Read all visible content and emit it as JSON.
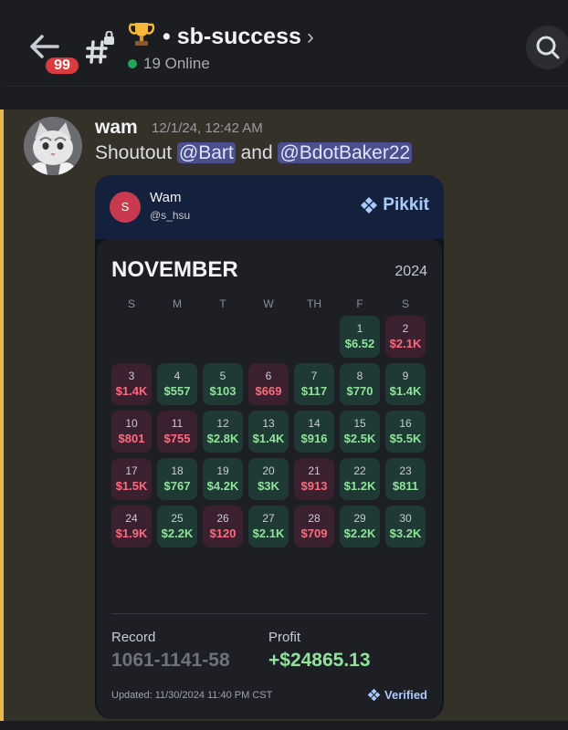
{
  "header": {
    "unread_count": "99",
    "channel_emoji": "trophy-icon",
    "channel_name": "• sb-success",
    "chevron": "›",
    "online_text": "19 Online"
  },
  "message": {
    "author": "wam",
    "timestamp": "12/1/24, 12:42 AM",
    "text_prefix": "Shoutout ",
    "mention_1": "@Bart",
    "text_middle": " and ",
    "mention_2": "@BdotBaker22"
  },
  "card": {
    "avatar_initial": "S",
    "user_name": "Wam",
    "user_handle": "@s_hsu",
    "brand": "Pikkit",
    "month": "NOVEMBER",
    "year": "2024",
    "weekdays": [
      "S",
      "M",
      "T",
      "W",
      "TH",
      "F",
      "S"
    ],
    "days": [
      {
        "day": "1",
        "amount": "$6.52",
        "result": "win"
      },
      {
        "day": "2",
        "amount": "$2.1K",
        "result": "loss"
      },
      {
        "day": "3",
        "amount": "$1.4K",
        "result": "loss"
      },
      {
        "day": "4",
        "amount": "$557",
        "result": "win"
      },
      {
        "day": "5",
        "amount": "$103",
        "result": "win"
      },
      {
        "day": "6",
        "amount": "$669",
        "result": "loss"
      },
      {
        "day": "7",
        "amount": "$117",
        "result": "win"
      },
      {
        "day": "8",
        "amount": "$770",
        "result": "win"
      },
      {
        "day": "9",
        "amount": "$1.4K",
        "result": "win"
      },
      {
        "day": "10",
        "amount": "$801",
        "result": "loss"
      },
      {
        "day": "11",
        "amount": "$755",
        "result": "loss"
      },
      {
        "day": "12",
        "amount": "$2.8K",
        "result": "win"
      },
      {
        "day": "13",
        "amount": "$1.4K",
        "result": "win"
      },
      {
        "day": "14",
        "amount": "$916",
        "result": "win"
      },
      {
        "day": "15",
        "amount": "$2.5K",
        "result": "win"
      },
      {
        "day": "16",
        "amount": "$5.5K",
        "result": "win"
      },
      {
        "day": "17",
        "amount": "$1.5K",
        "result": "loss"
      },
      {
        "day": "18",
        "amount": "$767",
        "result": "win"
      },
      {
        "day": "19",
        "amount": "$4.2K",
        "result": "win"
      },
      {
        "day": "20",
        "amount": "$3K",
        "result": "win"
      },
      {
        "day": "21",
        "amount": "$913",
        "result": "loss"
      },
      {
        "day": "22",
        "amount": "$1.2K",
        "result": "win"
      },
      {
        "day": "23",
        "amount": "$811",
        "result": "win"
      },
      {
        "day": "24",
        "amount": "$1.9K",
        "result": "loss"
      },
      {
        "day": "25",
        "amount": "$2.2K",
        "result": "win"
      },
      {
        "day": "26",
        "amount": "$120",
        "result": "loss"
      },
      {
        "day": "27",
        "amount": "$2.1K",
        "result": "win"
      },
      {
        "day": "28",
        "amount": "$709",
        "result": "loss"
      },
      {
        "day": "29",
        "amount": "$2.2K",
        "result": "win"
      },
      {
        "day": "30",
        "amount": "$3.2K",
        "result": "win"
      }
    ],
    "record_label": "Record",
    "record_value": "1061-1141-58",
    "profit_label": "Profit",
    "profit_value": "+$24865.13",
    "updated_text": "Updated: 11/30/2024 11:40 PM CST",
    "verified_label": "Verified"
  },
  "colors": {
    "win": "#8fe39a",
    "loss": "#ff6b7d",
    "accent": "#a9cbff",
    "highlight_bar": "#e9b84d"
  }
}
